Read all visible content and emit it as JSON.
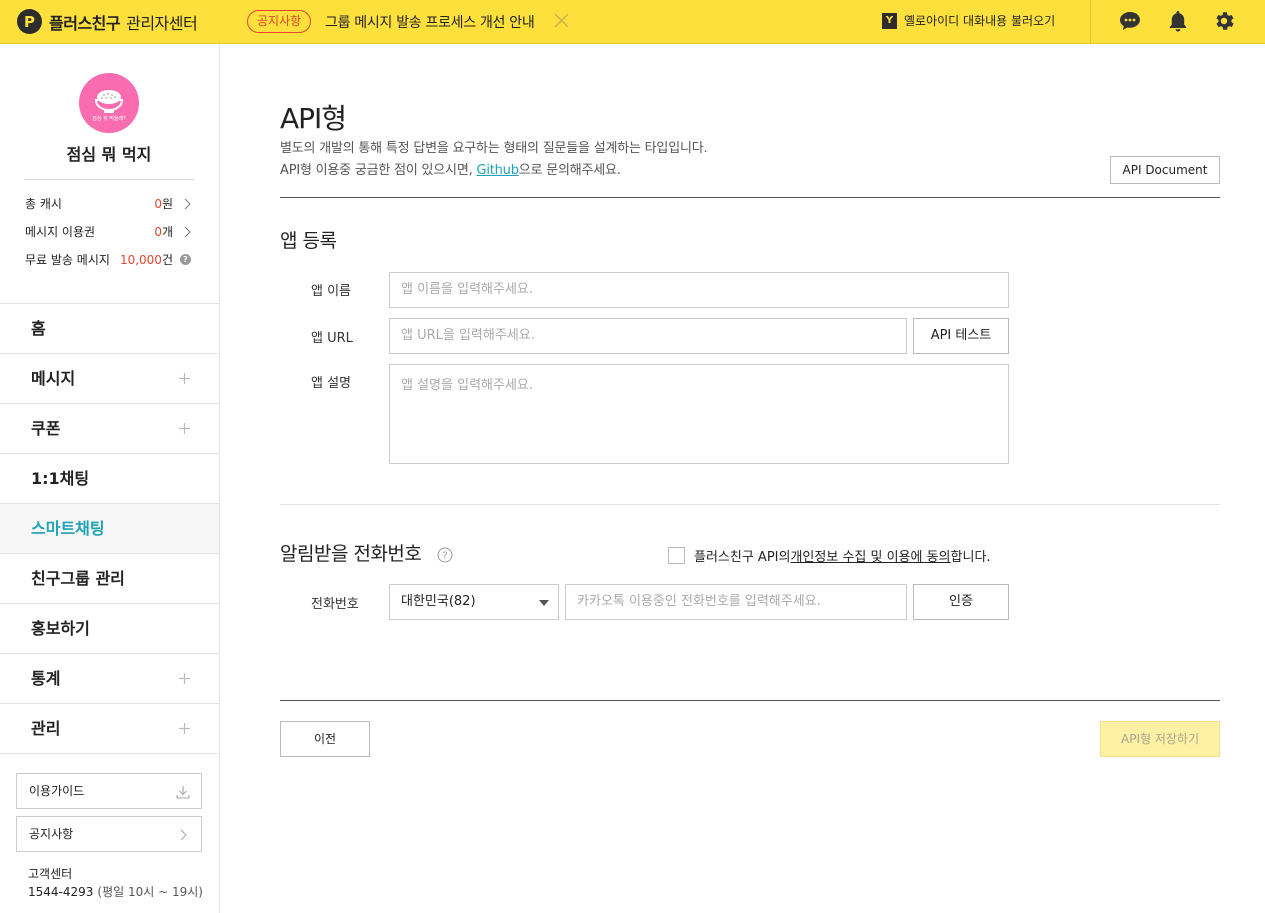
{
  "topbar": {
    "logo_mark": "P",
    "logo_title": "플러스친구",
    "logo_subtitle": "관리자센터",
    "notice_badge": "공지사항",
    "notice_text": "그룹 메시지 발송 프로세스 개선 안내",
    "yellowid_mark": "Y",
    "yellowid_label": "옐로아이디 대화내용 불러오기",
    "icons": [
      "chat-icon",
      "bell-icon",
      "gear-icon"
    ]
  },
  "sidebar": {
    "profile_name": "점심 뭐 먹지",
    "avatar_caption": "점심 뭐 먹을래?",
    "stats": [
      {
        "label": "총 캐시",
        "value": "0",
        "unit": "원"
      },
      {
        "label": "메시지 이용권",
        "value": "0",
        "unit": "개"
      },
      {
        "label": "무료 발송 메시지",
        "value": "10,000",
        "unit": "건"
      }
    ],
    "nav": [
      {
        "label": "홈",
        "expandable": false
      },
      {
        "label": "메시지",
        "expandable": true
      },
      {
        "label": "쿠폰",
        "expandable": true
      },
      {
        "label": "1:1채팅",
        "expandable": false
      },
      {
        "label": "스마트채팅",
        "expandable": false,
        "active": true
      },
      {
        "label": "친구그룹 관리",
        "expandable": false
      },
      {
        "label": "홍보하기",
        "expandable": false
      },
      {
        "label": "통계",
        "expandable": true
      },
      {
        "label": "관리",
        "expandable": true
      }
    ],
    "guide_button": "이용가이드",
    "notice_button": "공지사항",
    "cs_title": "고객센터",
    "cs_phone": "1544-4293",
    "cs_hours": "(평일 10시 ~ 19시)"
  },
  "main": {
    "title": "API형",
    "desc_line1": "별도의 개발의 통해 특정 답변을 요구하는 형태의 질문들을 설계하는 타입입니다.",
    "desc_line2_pre": "API형 이용중 궁금한 점이 있으시면, ",
    "desc_line2_link": "Github",
    "desc_line2_post": "으로 문의해주세요.",
    "api_document_button": "API Document",
    "app_section": {
      "title": "앱 등록",
      "name_label": "앱 이름",
      "name_placeholder": "앱 이름을 입력해주세요.",
      "url_label": "앱 URL",
      "url_placeholder": "앱 URL을 입력해주세요.",
      "api_test_button": "API 테스트",
      "desc_label": "앱 설명",
      "desc_placeholder": "앱 설명을 입력해주세요."
    },
    "phone_section": {
      "title": "알림받을 전화번호",
      "consent_pre": "플러스친구 API의 ",
      "consent_link": "개인정보 수집 및 이용에 동의",
      "consent_post": "합니다.",
      "phone_label": "전화번호",
      "country_selected": "대한민국(82)",
      "phone_placeholder": "카카오톡 이용중인 전화번호를 입력해주세요.",
      "verify_button": "인증"
    },
    "prev_button": "이전",
    "save_button": "API형 저장하기"
  },
  "colors": {
    "topbar": "#fee03c",
    "accent_teal": "#1fa3b5",
    "notice_red": "#e2462f",
    "avatar_pink": "#f96cb0",
    "save_disabled": "#fef0a4"
  }
}
